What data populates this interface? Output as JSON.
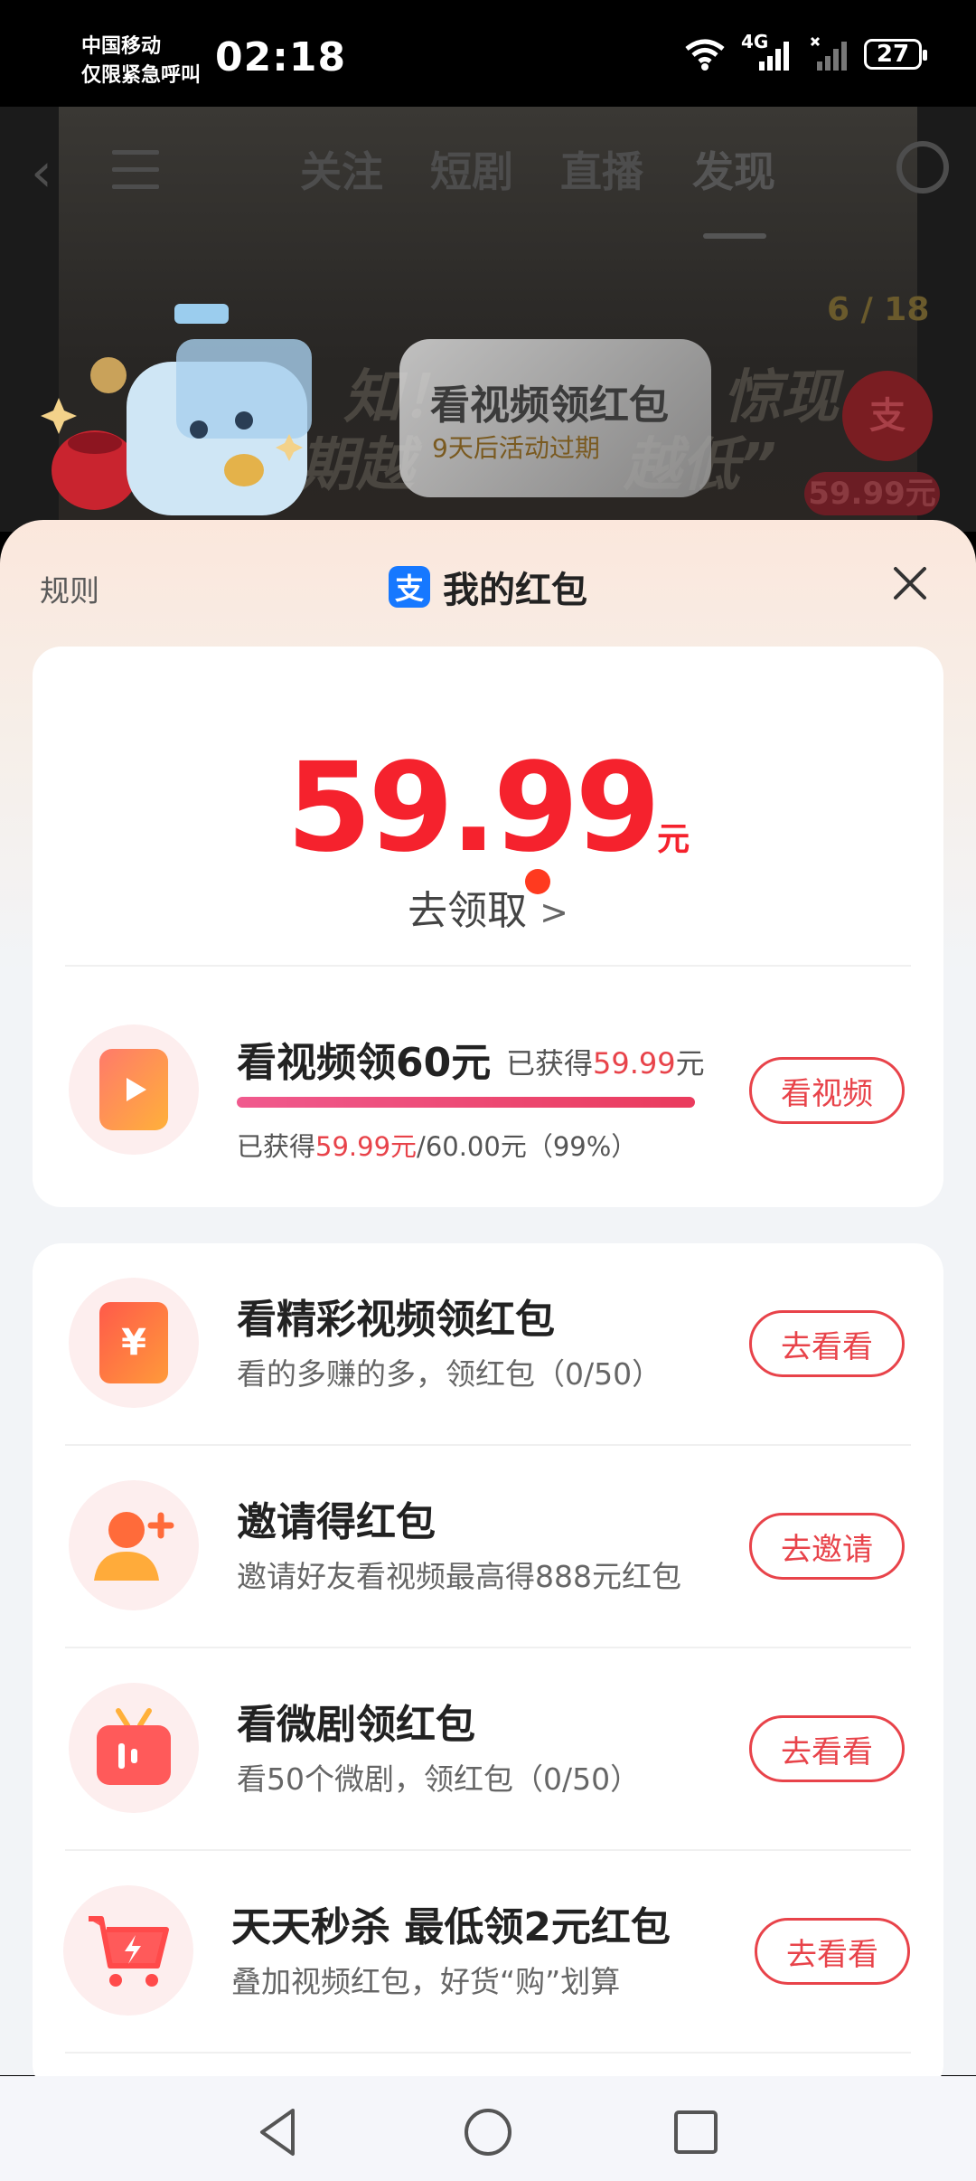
{
  "status_bar": {
    "carrier_line1": "中国移动",
    "carrier_line2": "仅限紧急呼叫",
    "time": "02:18",
    "network": "4G",
    "battery": "27"
  },
  "background": {
    "tabs": [
      "关注",
      "短剧",
      "直播",
      "发现"
    ],
    "active_tab": "发现",
    "bubble_title": "看视频领红包",
    "bubble_sub": "9天后活动过期",
    "counter": "6 / 18",
    "ali_char": "支",
    "side_price": "59.99元",
    "bg_text_1": "知！",
    "bg_text_2": "惊现",
    "bg_text_3": "期越",
    "bg_text_4": "越低”"
  },
  "sheet": {
    "rules": "规则",
    "title": "我的红包",
    "ali_char": "支",
    "amount": "59.99",
    "unit": "元",
    "claim": "去领取",
    "claim_arrow": ">"
  },
  "video_task": {
    "title": "看视频领60元",
    "got_prefix": "已获得",
    "got_value": "59.99",
    "got_unit": "元",
    "progress_prefix": "已获得",
    "progress_value": "59.99元",
    "progress_rest": "/60.00元（99%）",
    "progress": 0.99,
    "button": "看视频"
  },
  "tasks": [
    {
      "title": "看精彩视频领红包",
      "sub": "看的多赚的多，领红包（0/50）",
      "button": "去看看"
    },
    {
      "title": "邀请得红包",
      "sub": "邀请好友看视频最高得888元红包",
      "button": "去邀请"
    },
    {
      "title": "看微剧领红包",
      "sub": "看50个微剧，领红包（0/50）",
      "button": "去看看"
    },
    {
      "title": "天天秒杀 最低领2元红包",
      "sub": "叠加视频红包，好货“购”划算",
      "button": "去看看"
    }
  ],
  "colors": {
    "accent_red": "#e8434a",
    "amount_red": "#f5222d",
    "alipay_blue": "#1678ff"
  }
}
